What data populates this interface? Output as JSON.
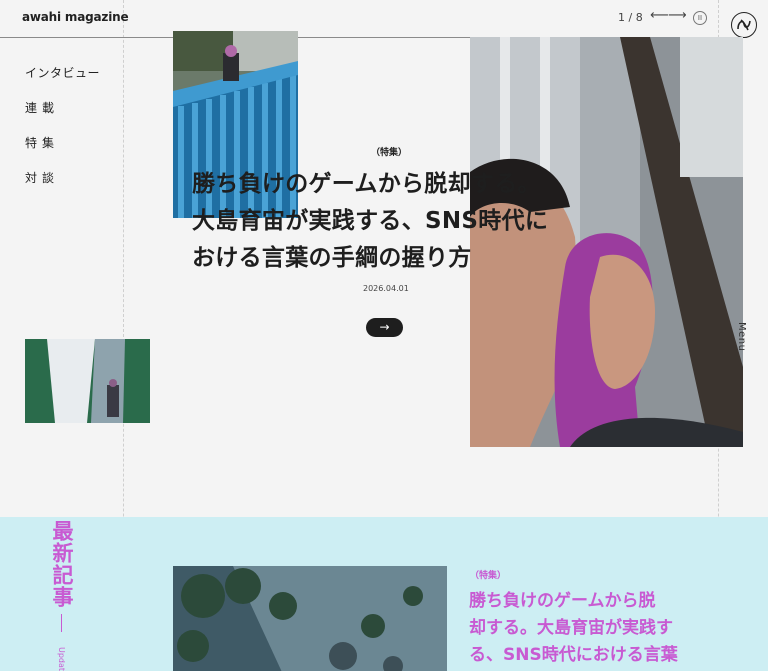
{
  "header": {
    "logo": "awahi magazine",
    "counter": "1 / 8",
    "prev_glyph": "⟵",
    "next_glyph": "⟶",
    "pause_glyph": "II"
  },
  "nav": {
    "items": [
      "インタビュー",
      "連載",
      "特集",
      "対談"
    ]
  },
  "hero": {
    "category": "（特集）",
    "title_lines": [
      "勝ち負けのゲームから脱却する。",
      "大島育宙が実践する、SNS時代に",
      "おける言葉の手綱の握り方"
    ],
    "date": "2026.04.01",
    "arrow_glyph": "→"
  },
  "side": {
    "menu_label": "Menu"
  },
  "latest": {
    "heading": "最新記事",
    "sub": "Update",
    "category": "（特集）",
    "title_lines": [
      "勝ち負けのゲームから脱",
      "却する。大島育宙が実践す",
      "る、SNS時代における言葉"
    ]
  },
  "colors": {
    "accent": "#c85ad2",
    "latest_bg": "#cdeef3",
    "text": "#1e1e1e"
  }
}
